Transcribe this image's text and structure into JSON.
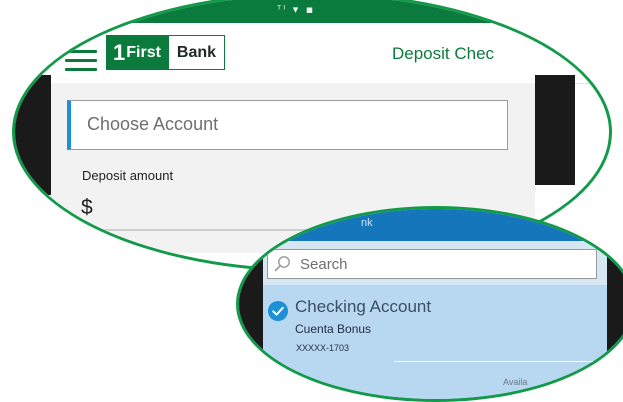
{
  "status_bar": {
    "icons": "ᵀᴵ ▾ ▪"
  },
  "header": {
    "logo_number": "1",
    "logo_first": "First",
    "logo_bank": "Bank",
    "title": "Deposit Chec"
  },
  "form": {
    "choose_account_label": "Choose Account",
    "deposit_amount_label": "Deposit amount",
    "currency_symbol": "$"
  },
  "picker": {
    "header_text": "nk",
    "search_placeholder": "Search",
    "account": {
      "name": "Checking Account",
      "subtitle": "Cuenta Bonus",
      "number": "XXXXX-1703"
    },
    "available_text": "Availa"
  },
  "colors": {
    "brand_green": "#0b7a3d",
    "lens_border": "#129a4a",
    "accent_blue": "#1d8fd6",
    "selected_row": "#b8d7f0"
  },
  "icons": [
    "menu-icon",
    "search-icon",
    "check-icon"
  ]
}
